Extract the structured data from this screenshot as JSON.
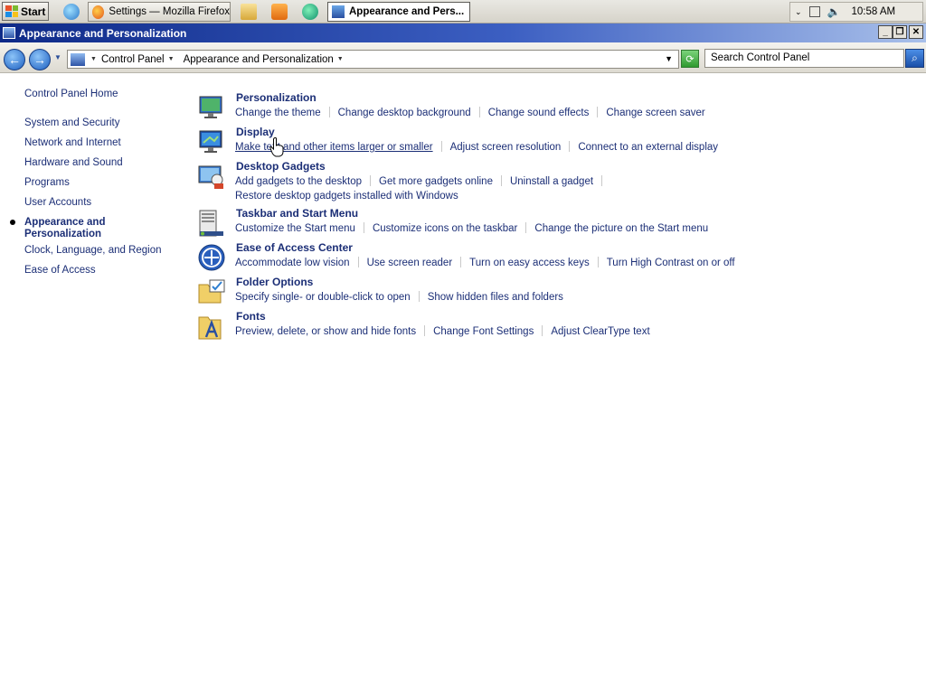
{
  "taskbar": {
    "start_label": "Start",
    "tasks": [
      {
        "label": "Settings — Mozilla Firefox"
      },
      {
        "label": "Appearance and Pers..."
      }
    ],
    "clock": "10:58 AM"
  },
  "window": {
    "title": "Appearance and Personalization"
  },
  "address": {
    "crumbs": [
      "Control Panel",
      "Appearance and Personalization"
    ],
    "search_placeholder": "Search Control Panel"
  },
  "leftnav": {
    "items": [
      {
        "label": "Control Panel Home"
      },
      {
        "label": "System and Security"
      },
      {
        "label": "Network and Internet"
      },
      {
        "label": "Hardware and Sound"
      },
      {
        "label": "Programs"
      },
      {
        "label": "User Accounts"
      },
      {
        "label": "Appearance and",
        "label2": "Personalization"
      },
      {
        "label": "Clock, Language, and Region"
      },
      {
        "label": "Ease of Access"
      }
    ]
  },
  "groups": [
    {
      "title": "Personalization",
      "icon": "personalization-icon",
      "links": [
        "Change the theme",
        "Change desktop background",
        "Change sound effects",
        "Change screen saver"
      ]
    },
    {
      "title": "Display",
      "icon": "display-icon",
      "links": [
        "Make text and other items larger or smaller",
        "Adjust screen resolution",
        "Connect to an external display"
      ]
    },
    {
      "title": "Desktop Gadgets",
      "icon": "gadgets-icon",
      "links": [
        "Add gadgets to the desktop",
        "Get more gadgets online",
        "Uninstall a gadget",
        "Restore desktop gadgets installed with Windows"
      ]
    },
    {
      "title": "Taskbar and Start Menu",
      "icon": "taskbar-icon",
      "links": [
        "Customize the Start menu",
        "Customize icons on the taskbar",
        "Change the picture on the Start menu"
      ]
    },
    {
      "title": "Ease of Access Center",
      "icon": "ease-of-access-icon",
      "links": [
        "Accommodate low vision",
        "Use screen reader",
        "Turn on easy access keys",
        "Turn High Contrast on or off"
      ]
    },
    {
      "title": "Folder Options",
      "icon": "folder-options-icon",
      "links": [
        "Specify single- or double-click to open",
        "Show hidden files and folders"
      ]
    },
    {
      "title": "Fonts",
      "icon": "fonts-icon",
      "links": [
        "Preview, delete, or show and hide fonts",
        "Change Font Settings",
        "Adjust ClearType text"
      ]
    }
  ]
}
